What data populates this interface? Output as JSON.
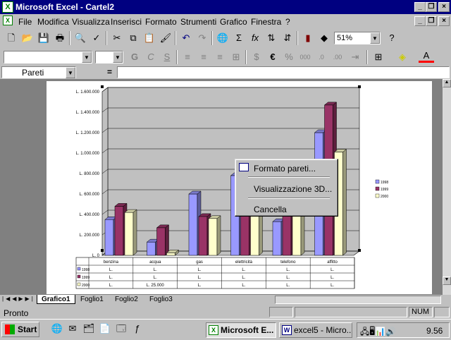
{
  "window": {
    "title": "Microsoft Excel - Cartel2",
    "app_icon": "X"
  },
  "menu": [
    "File",
    "Modifica",
    "Visualizza",
    "Inserisci",
    "Formato",
    "Strumenti",
    "Grafico",
    "Finestra",
    "?"
  ],
  "toolbar": {
    "zoom": "51%",
    "name_box": "Pareti",
    "formula_eq": "=",
    "font_buttons": [
      "G",
      "C",
      "S"
    ],
    "currency": "€",
    "percent": "%"
  },
  "chart_data": {
    "type": "bar",
    "categories": [
      "benzina",
      "acqua",
      "gas",
      "elettricità",
      "telefono",
      "affitto"
    ],
    "series": [
      {
        "name": "1998",
        "values": [
          350000,
          130000,
          600000,
          780000,
          330000,
          1200000
        ]
      },
      {
        "name": "1999",
        "values": [
          480000,
          270000,
          380000,
          620000,
          430000,
          1470000
        ]
      },
      {
        "name": "2000",
        "values": [
          420000,
          25000,
          360000,
          600000,
          480000,
          1010000
        ]
      }
    ],
    "y_ticks": [
      "L. 1.600.000",
      "L. 1.400.000",
      "L. 1.200.000",
      "L. 1.000.000",
      "L. 800.000",
      "L. 600.000",
      "L. 400.000",
      "L. 200.000",
      "L. 0"
    ],
    "ylim": [
      0,
      1600000
    ],
    "legend": [
      "1998",
      "1999",
      "2000"
    ],
    "colors": [
      "#9999ff",
      "#993366",
      "#ffffcc"
    ],
    "table_rows": [
      {
        "label": "1998",
        "cells": [
          "L.",
          "L.",
          "L.",
          "L.",
          "L.",
          "L."
        ]
      },
      {
        "label": "1999",
        "cells": [
          "L.",
          "L.",
          "L.",
          "L.",
          "L.",
          "L."
        ]
      },
      {
        "label": "2000",
        "cells": [
          "L.",
          "L. 25.000",
          "L.",
          "L.",
          "L.",
          "L."
        ]
      }
    ]
  },
  "context_menu": {
    "items": [
      "Formato pareti...",
      "Visualizzazione 3D...",
      "Cancella"
    ]
  },
  "sheet_tabs": [
    "Grafico1",
    "Foglio1",
    "Foglio2",
    "Foglio3"
  ],
  "status": {
    "text": "Pronto",
    "num": "NUM"
  },
  "taskbar": {
    "start": "Start",
    "tasks": [
      "Microsoft E...",
      "excel5 - Micro..."
    ],
    "clock": "9.56"
  }
}
